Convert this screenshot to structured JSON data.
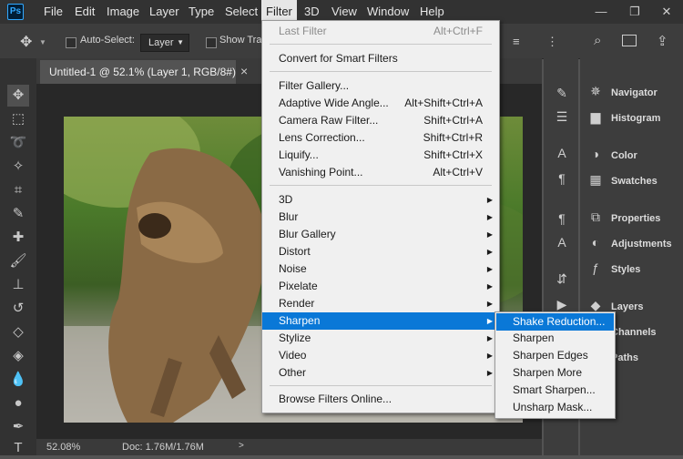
{
  "app": {
    "logo": "Ps"
  },
  "menubar": {
    "items": [
      "File",
      "Edit",
      "Image",
      "Layer",
      "Type",
      "Select",
      "Filter",
      "3D",
      "View",
      "Window",
      "Help"
    ],
    "window_controls": [
      "—",
      "❐",
      "✕"
    ]
  },
  "options": {
    "auto_select_label": "Auto-Select:",
    "layer_value": "Layer",
    "show_transform_label": "Show Tran"
  },
  "document": {
    "tab_title": "Untitled-1 @ 52.1% (Layer 1, RGB/8#) *",
    "tab_close": "×"
  },
  "status": {
    "zoom": "52.08%",
    "doc": "Doc: 1.76M/1.76M"
  },
  "filter_menu": {
    "items": [
      {
        "label": "Last Filter",
        "shortcut": "Alt+Ctrl+F",
        "disabled": true
      },
      {
        "label": "Convert for Smart Filters",
        "shortcut": ""
      },
      {
        "label": "Filter Gallery...",
        "shortcut": ""
      },
      {
        "label": "Adaptive Wide Angle...",
        "shortcut": "Alt+Shift+Ctrl+A"
      },
      {
        "label": "Camera Raw Filter...",
        "shortcut": "Shift+Ctrl+A"
      },
      {
        "label": "Lens Correction...",
        "shortcut": "Shift+Ctrl+R"
      },
      {
        "label": "Liquify...",
        "shortcut": "Shift+Ctrl+X"
      },
      {
        "label": "Vanishing Point...",
        "shortcut": "Alt+Ctrl+V"
      },
      {
        "label": "3D",
        "submenu": true
      },
      {
        "label": "Blur",
        "submenu": true
      },
      {
        "label": "Blur Gallery",
        "submenu": true
      },
      {
        "label": "Distort",
        "submenu": true
      },
      {
        "label": "Noise",
        "submenu": true
      },
      {
        "label": "Pixelate",
        "submenu": true
      },
      {
        "label": "Render",
        "submenu": true
      },
      {
        "label": "Sharpen",
        "submenu": true,
        "highlighted": true
      },
      {
        "label": "Stylize",
        "submenu": true
      },
      {
        "label": "Video",
        "submenu": true
      },
      {
        "label": "Other",
        "submenu": true
      },
      {
        "label": "Browse Filters Online...",
        "shortcut": ""
      }
    ]
  },
  "sharpen_submenu": {
    "items": [
      "Shake Reduction...",
      "Sharpen",
      "Sharpen Edges",
      "Sharpen More",
      "Smart Sharpen...",
      "Unsharp Mask..."
    ]
  },
  "panels": {
    "items": [
      "Navigator",
      "Histogram",
      "Color",
      "Swatches",
      "Properties",
      "Adjustments",
      "Styles",
      "Layers",
      "Channels",
      "Paths"
    ]
  },
  "colors": {
    "highlight": "#0a78d7",
    "menu_bg": "#f0f0f0",
    "app_bg": "#535353"
  }
}
